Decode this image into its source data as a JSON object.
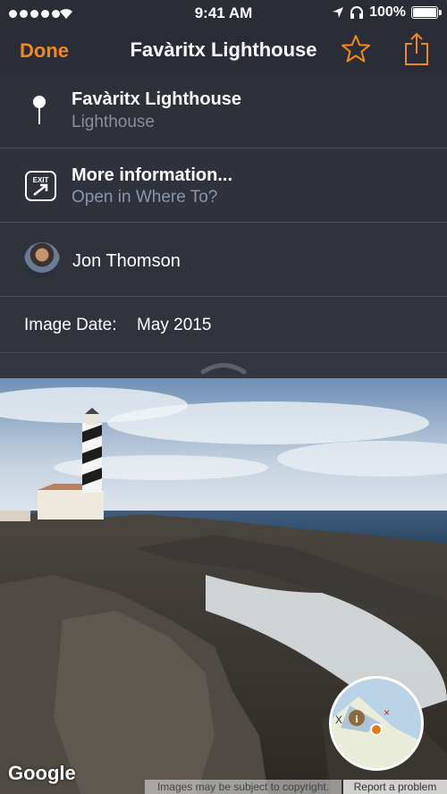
{
  "status": {
    "time": "9:41 AM",
    "battery": "100%",
    "battery_level": 1.0,
    "signal_bars": 5
  },
  "nav": {
    "done_label": "Done",
    "title": "Favàritx Lighthouse",
    "star_icon": "star-outline-icon",
    "share_icon": "share-icon"
  },
  "place": {
    "name": "Favàritx Lighthouse",
    "category": "Lighthouse"
  },
  "info": {
    "title": "More information...",
    "subtitle": "Open in Where To?",
    "icon": "exit-icon",
    "icon_text": "EXIT"
  },
  "author": {
    "name": "Jon Thomson"
  },
  "image_date": {
    "label": "Image Date:",
    "value": "May 2015"
  },
  "photo": {
    "brand": "Google",
    "copyright": "Images may be subject to copyright.",
    "report": "Report a problem"
  },
  "colors": {
    "accent": "#f08a1d",
    "panel_bg": "#2e313a",
    "divider": "#4b4e57",
    "subtitle": "#8a8e9c",
    "link_subtitle": "#8b95b0"
  }
}
